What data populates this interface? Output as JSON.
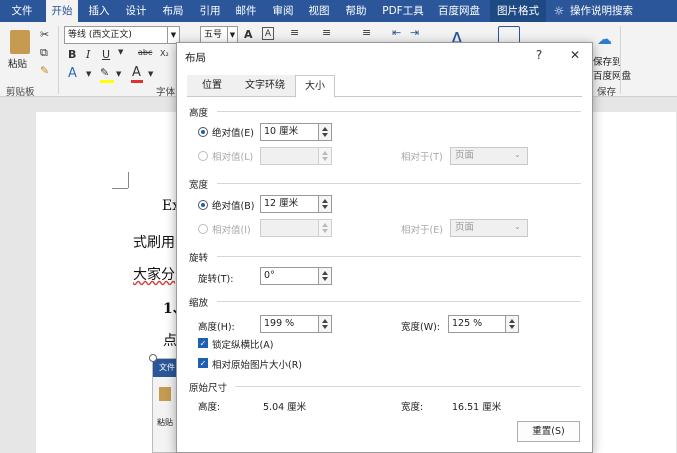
{
  "ribbon": {
    "tabs": [
      "文件",
      "开始",
      "插入",
      "设计",
      "布局",
      "引用",
      "邮件",
      "审阅",
      "视图",
      "帮助",
      "PDF工具",
      "百度网盘",
      "图片格式"
    ],
    "active_tab": "开始",
    "search_hint": "操作说明搜索",
    "font_name": "等线 (西文正文)",
    "font_size": "五号",
    "paste_label": "粘贴",
    "clipboard_group": "剪贴板",
    "font_group": "字体",
    "save_group": "保存",
    "baidu_save_line1": "保存到",
    "baidu_save_line2": "百度网盘"
  },
  "document": {
    "line1": "Ex",
    "line2": "式刷用",
    "line3": "大家分",
    "line4": "1、",
    "line5": "点"
  },
  "inset": {
    "file_tab": "文件",
    "paste_label": "粘贴"
  },
  "dialog": {
    "title": "布局",
    "help": "?",
    "close": "✕",
    "tabs": [
      "位置",
      "文字环绕",
      "大小"
    ],
    "height": {
      "section": "高度",
      "absolute_label": "绝对值(E)",
      "absolute_value": "10 厘米",
      "relative_label": "相对值(L)",
      "relative_to_label": "相对于(T)",
      "relative_to_value": "页面"
    },
    "width": {
      "section": "宽度",
      "absolute_label": "绝对值(B)",
      "absolute_value": "12 厘米",
      "relative_label": "相对值(I)",
      "relative_to_label": "相对于(E)",
      "relative_to_value": "页面"
    },
    "rotate": {
      "section": "旋转",
      "label": "旋转(T):",
      "value": "0°"
    },
    "scale": {
      "section": "缩放",
      "height_label": "高度(H):",
      "height_value": "199 %",
      "width_label": "宽度(W):",
      "width_value": "125 %",
      "lock_aspect": "锁定纵横比(A)",
      "relative_original": "相对原始图片大小(R)"
    },
    "original": {
      "section": "原始尺寸",
      "height_label": "高度:",
      "height_value": "5.04 厘米",
      "width_label": "宽度:",
      "width_value": "16.51 厘米"
    },
    "reset_button": "重置(S)"
  }
}
